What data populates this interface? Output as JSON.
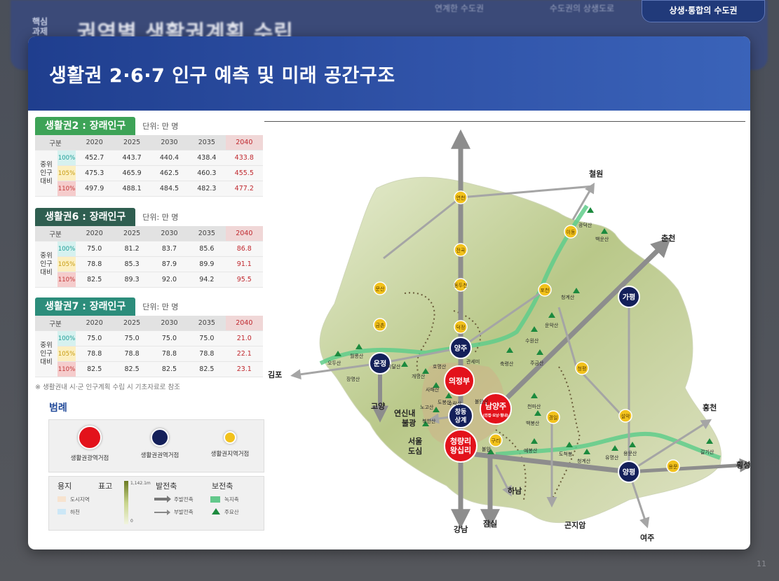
{
  "background": {
    "side_label_line1": "핵심",
    "side_label_line2": "과제",
    "title": "권역별 생활권계획 수립",
    "tabs": [
      "연계한 수도권",
      "수도권의 상생도로",
      "상생·통합의 수도권"
    ],
    "pager": "11"
  },
  "card": {
    "title": "생활권 2·6·7 인구 예측 및 미래 공간구조"
  },
  "tables": [
    {
      "label": "생활권2 : 장래인구",
      "unit": "단위: 만 명",
      "header": [
        "구분",
        "2020",
        "2025",
        "2030",
        "2035",
        "2040"
      ],
      "group": "중위인구대비",
      "rows": [
        {
          "pct": "100%",
          "values": [
            "452.7",
            "443.7",
            "440.4",
            "438.4",
            "433.8"
          ]
        },
        {
          "pct": "105%",
          "values": [
            "475.3",
            "465.9",
            "462.5",
            "460.3",
            "455.5"
          ]
        },
        {
          "pct": "110%",
          "values": [
            "497.9",
            "488.1",
            "484.5",
            "482.3",
            "477.2"
          ]
        }
      ]
    },
    {
      "label": "생활권6 : 장래인구",
      "unit": "단위: 만 명",
      "header": [
        "구분",
        "2020",
        "2025",
        "2030",
        "2035",
        "2040"
      ],
      "group": "중위인구대비",
      "rows": [
        {
          "pct": "100%",
          "values": [
            "75.0",
            "81.2",
            "83.7",
            "85.6",
            "86.8"
          ]
        },
        {
          "pct": "105%",
          "values": [
            "78.8",
            "85.3",
            "87.9",
            "89.9",
            "91.1"
          ]
        },
        {
          "pct": "110%",
          "values": [
            "82.5",
            "89.3",
            "92.0",
            "94.2",
            "95.5"
          ]
        }
      ]
    },
    {
      "label": "생활권7 : 장래인구",
      "unit": "단위: 만 명",
      "header": [
        "구분",
        "2020",
        "2025",
        "2030",
        "2035",
        "2040"
      ],
      "group": "중위인구대비",
      "rows": [
        {
          "pct": "100%",
          "values": [
            "75.0",
            "75.0",
            "75.0",
            "75.0",
            "21.0"
          ]
        },
        {
          "pct": "105%",
          "values": [
            "78.8",
            "78.8",
            "78.8",
            "78.8",
            "22.1"
          ]
        },
        {
          "pct": "110%",
          "values": [
            "82.5",
            "82.5",
            "82.5",
            "82.5",
            "23.1"
          ]
        }
      ]
    }
  ],
  "note": "※ 생활권내 시·군 인구계획 수립 시 기초자료로 참조",
  "legend": {
    "title": "범례",
    "items": [
      {
        "label": "생활권광역거점",
        "color": "#e3121b"
      },
      {
        "label": "생활권권역거점",
        "color": "#14205a"
      },
      {
        "label": "생활권지역거점",
        "color": "#f2c21c"
      }
    ],
    "landuse": {
      "title": "용지",
      "urban": "도시지역",
      "river": "하천"
    },
    "elevation": {
      "title": "표고",
      "max": "1,142.1m",
      "min": "0"
    },
    "axes": {
      "title": "발전축",
      "main": "주발전축",
      "sub": "부발전축"
    },
    "conservation": {
      "title": "보전축",
      "green": "녹지축",
      "mountain": "주요산"
    }
  },
  "map": {
    "external": [
      {
        "name": "철원"
      },
      {
        "name": "춘천"
      },
      {
        "name": "홍천"
      },
      {
        "name": "횡성"
      },
      {
        "name": "김포"
      },
      {
        "name": "고양"
      },
      {
        "name": "연신내\n불광"
      },
      {
        "name": "서울\n도심"
      },
      {
        "name": "강남"
      },
      {
        "name": "잠실"
      },
      {
        "name": "하남"
      },
      {
        "name": "곤지암"
      },
      {
        "name": "여주"
      }
    ],
    "hubs_red": [
      "의정부",
      "남양주",
      "청량리\n왕십리"
    ],
    "hubs_red_sub": "(진접·오남·별내)",
    "hubs_navy": [
      "양주",
      "운정",
      "가평",
      "양평",
      "창동\n상계"
    ],
    "hubs_yellow": [
      "연천",
      "전곡",
      "동두천",
      "문산",
      "금촌",
      "포천",
      "이동",
      "덕정",
      "청평",
      "설악",
      "용문",
      "구리",
      "경일"
    ],
    "mountains": [
      "광덕산",
      "백운산",
      "청계산",
      "운악산",
      "수원산",
      "축령산",
      "주금산",
      "천마산",
      "백봉산",
      "예봉산",
      "도척봉",
      "청계산",
      "유명산",
      "용문산",
      "갈기산",
      "오두산",
      "월롱산",
      "장명산",
      "박달산",
      "개명산",
      "호명산",
      "사패산",
      "도봉산",
      "수락산",
      "불암산",
      "북한산",
      "노고산",
      "관세미",
      "불암"
    ]
  }
}
